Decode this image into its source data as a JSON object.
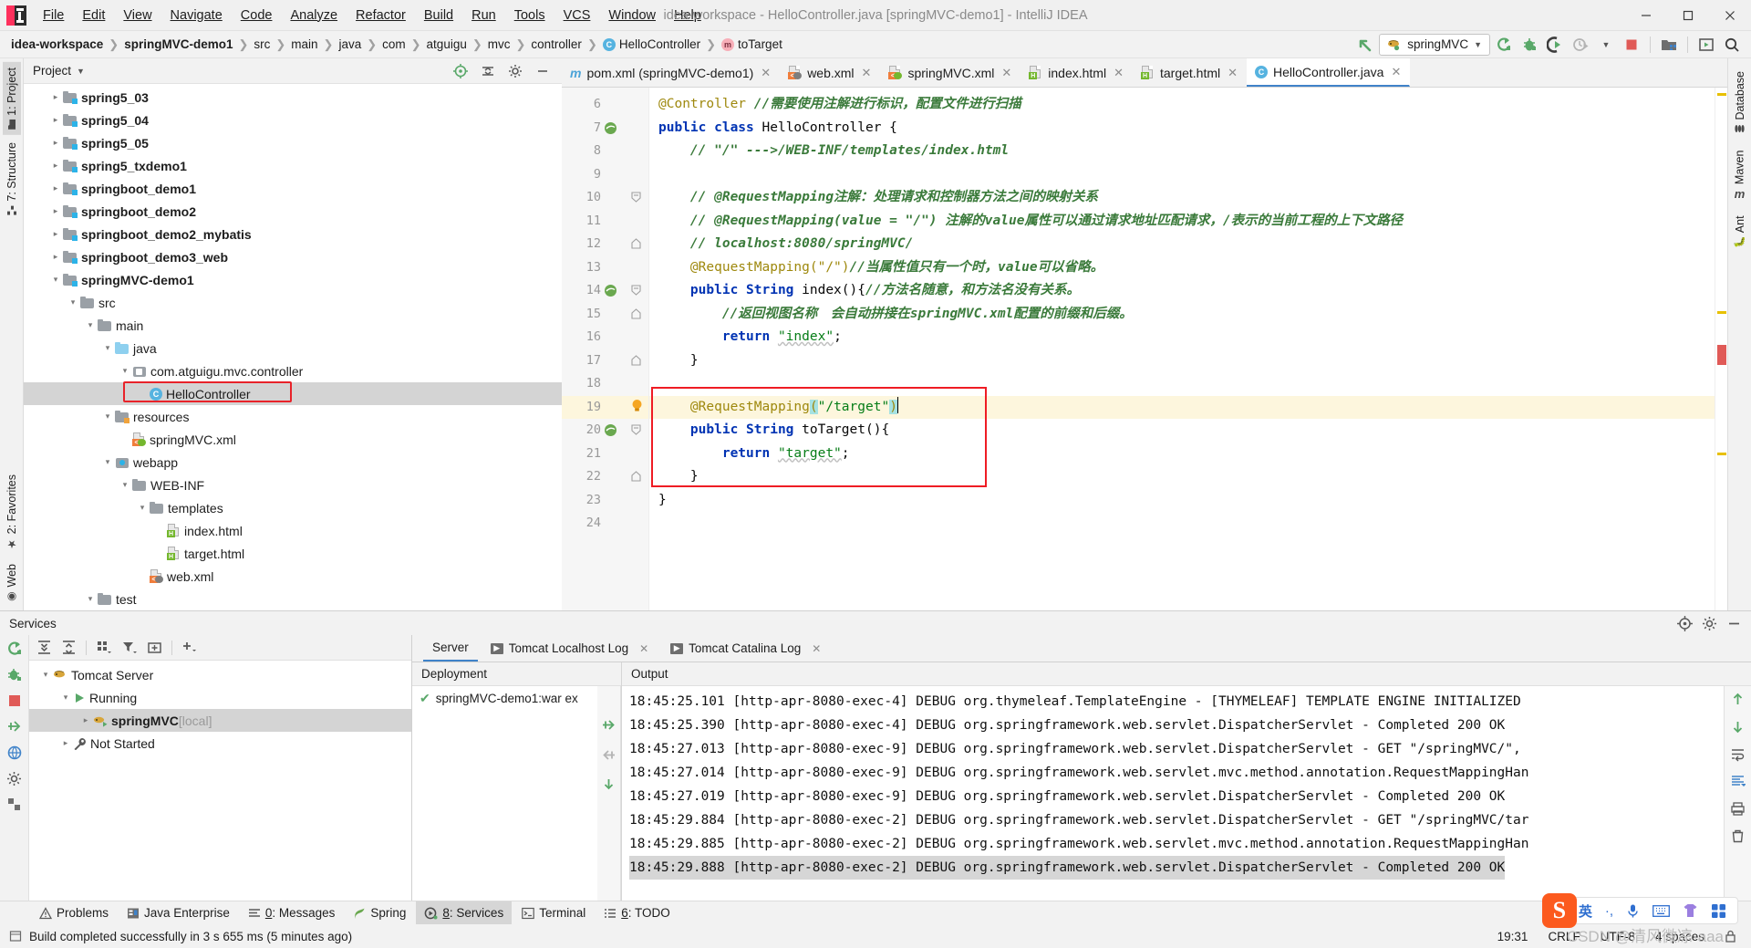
{
  "window": {
    "title": "idea-workspace - HelloController.java [springMVC-demo1] - IntelliJ IDEA",
    "minimize": "–",
    "maximize": "❐",
    "close": "✕"
  },
  "menubar": {
    "items": [
      "File",
      "Edit",
      "View",
      "Navigate",
      "Code",
      "Analyze",
      "Refactor",
      "Build",
      "Run",
      "Tools",
      "VCS",
      "Window",
      "Help"
    ]
  },
  "breadcrumb": {
    "items": [
      {
        "label": "idea-workspace",
        "bold": true,
        "icon": "none"
      },
      {
        "label": "springMVC-demo1",
        "bold": true,
        "icon": "none"
      },
      {
        "label": "src",
        "bold": false,
        "icon": "none"
      },
      {
        "label": "main",
        "bold": false,
        "icon": "none"
      },
      {
        "label": "java",
        "bold": false,
        "icon": "none"
      },
      {
        "label": "com",
        "bold": false,
        "icon": "none"
      },
      {
        "label": "atguigu",
        "bold": false,
        "icon": "none"
      },
      {
        "label": "mvc",
        "bold": false,
        "icon": "none"
      },
      {
        "label": "controller",
        "bold": false,
        "icon": "none"
      },
      {
        "label": "HelloController",
        "bold": false,
        "icon": "class"
      },
      {
        "label": "toTarget",
        "bold": false,
        "icon": "method"
      }
    ]
  },
  "toolbar": {
    "run_config": "springMVC",
    "dropdown_caret": "▼",
    "icons": [
      "back-arrow-icon",
      "rerun-icon",
      "debug-icon",
      "run-with-coverage-icon",
      "profiler-icon",
      "stop-icon",
      "project-structure-icon",
      "update-app-icon",
      "search-everywhere-icon"
    ],
    "accent_green": "#59a869",
    "accent_red": "#e05a57",
    "accent_blue": "#4083c9"
  },
  "left_rail": {
    "top": [
      {
        "label": "1: Project",
        "active": true,
        "icon": "project-icon"
      },
      {
        "label": "7: Structure",
        "active": false,
        "icon": "structure-icon"
      }
    ],
    "bottom": [
      {
        "label": "2: Favorites",
        "active": false,
        "icon": "star-icon"
      },
      {
        "label": "Web",
        "active": false,
        "icon": "web-icon"
      }
    ]
  },
  "right_rail": {
    "items": [
      {
        "label": "Database",
        "icon": "database-icon"
      },
      {
        "label": "Maven",
        "icon": "maven-icon"
      },
      {
        "label": "Ant",
        "icon": "ant-icon"
      }
    ]
  },
  "project_panel": {
    "title": "Project",
    "title_caret": "▾",
    "tree": [
      {
        "indent": 1,
        "twist": "▸",
        "icon": "module-folder",
        "label": "spring5_03",
        "bold": true,
        "selected": false
      },
      {
        "indent": 1,
        "twist": "▸",
        "icon": "module-folder",
        "label": "spring5_04",
        "bold": true,
        "selected": false
      },
      {
        "indent": 1,
        "twist": "▸",
        "icon": "module-folder",
        "label": "spring5_05",
        "bold": true,
        "selected": false
      },
      {
        "indent": 1,
        "twist": "▸",
        "icon": "module-folder",
        "label": "spring5_txdemo1",
        "bold": true,
        "selected": false
      },
      {
        "indent": 1,
        "twist": "▸",
        "icon": "module-folder",
        "label": "springboot_demo1",
        "bold": true,
        "selected": false
      },
      {
        "indent": 1,
        "twist": "▸",
        "icon": "module-folder",
        "label": "springboot_demo2",
        "bold": true,
        "selected": false
      },
      {
        "indent": 1,
        "twist": "▸",
        "icon": "module-folder",
        "label": "springboot_demo2_mybatis",
        "bold": true,
        "selected": false
      },
      {
        "indent": 1,
        "twist": "▸",
        "icon": "module-folder",
        "label": "springboot_demo3_web",
        "bold": true,
        "selected": false
      },
      {
        "indent": 1,
        "twist": "▾",
        "icon": "module-folder",
        "label": "springMVC-demo1",
        "bold": true,
        "selected": false
      },
      {
        "indent": 2,
        "twist": "▾",
        "icon": "folder",
        "label": "src",
        "bold": false,
        "selected": false
      },
      {
        "indent": 3,
        "twist": "▾",
        "icon": "folder",
        "label": "main",
        "bold": false,
        "selected": false
      },
      {
        "indent": 4,
        "twist": "▾",
        "icon": "source-folder",
        "label": "java",
        "bold": false,
        "selected": false
      },
      {
        "indent": 5,
        "twist": "▾",
        "icon": "package",
        "label": "com.atguigu.mvc.controller",
        "bold": false,
        "selected": false
      },
      {
        "indent": 6,
        "twist": "",
        "icon": "java-class",
        "label": "HelloController",
        "bold": false,
        "selected": true,
        "highlight": true
      },
      {
        "indent": 4,
        "twist": "▾",
        "icon": "resource-folder",
        "label": "resources",
        "bold": false,
        "selected": false
      },
      {
        "indent": 5,
        "twist": "",
        "icon": "spring-xml",
        "label": "springMVC.xml",
        "bold": false,
        "selected": false
      },
      {
        "indent": 4,
        "twist": "▾",
        "icon": "webapp-folder",
        "label": "webapp",
        "bold": false,
        "selected": false
      },
      {
        "indent": 5,
        "twist": "▾",
        "icon": "folder",
        "label": "WEB-INF",
        "bold": false,
        "selected": false
      },
      {
        "indent": 6,
        "twist": "▾",
        "icon": "folder",
        "label": "templates",
        "bold": false,
        "selected": false
      },
      {
        "indent": 7,
        "twist": "",
        "icon": "html-file",
        "label": "index.html",
        "bold": false,
        "selected": false
      },
      {
        "indent": 7,
        "twist": "",
        "icon": "html-file",
        "label": "target.html",
        "bold": false,
        "selected": false
      },
      {
        "indent": 6,
        "twist": "",
        "icon": "web-xml",
        "label": "web.xml",
        "bold": false,
        "selected": false
      },
      {
        "indent": 3,
        "twist": "▾",
        "icon": "folder",
        "label": "test",
        "bold": false,
        "selected": false
      }
    ]
  },
  "editor": {
    "tabs": [
      {
        "label": "pom.xml (springMVC-demo1)",
        "icon": "maven-file",
        "active": false,
        "close": "✕"
      },
      {
        "label": "web.xml",
        "icon": "web-xml",
        "active": false,
        "close": "✕"
      },
      {
        "label": "springMVC.xml",
        "icon": "spring-xml",
        "active": false,
        "close": "✕"
      },
      {
        "label": "index.html",
        "icon": "html-file",
        "active": false,
        "close": "✕"
      },
      {
        "label": "target.html",
        "icon": "html-file",
        "active": false,
        "close": "✕"
      },
      {
        "label": "HelloController.java",
        "icon": "java-class",
        "active": true,
        "close": "✕"
      }
    ],
    "lines": [
      {
        "n": 6,
        "gutter": "",
        "fold": "",
        "highlight": false,
        "segments": [
          {
            "t": "@Controller ",
            "c": "ann"
          },
          {
            "t": "//需要使用注解进行标识，配置文件进行扫描",
            "c": "cmt-g"
          }
        ]
      },
      {
        "n": 7,
        "gutter": "bean",
        "fold": "",
        "highlight": false,
        "segments": [
          {
            "t": "public class ",
            "c": "kw"
          },
          {
            "t": "HelloController {",
            "c": "plain"
          }
        ]
      },
      {
        "n": 8,
        "gutter": "",
        "fold": "",
        "highlight": false,
        "segments": [
          {
            "t": "    // \"/\" --->/WEB-INF/templates/index.html",
            "c": "cmt-g"
          }
        ]
      },
      {
        "n": 9,
        "gutter": "",
        "fold": "",
        "highlight": false,
        "segments": []
      },
      {
        "n": 10,
        "gutter": "",
        "fold": "open",
        "highlight": false,
        "segments": [
          {
            "t": "    // @RequestMapping注解：处理请求和控制器方法之间的映射关系",
            "c": "cmt-g"
          }
        ]
      },
      {
        "n": 11,
        "gutter": "",
        "fold": "",
        "highlight": false,
        "segments": [
          {
            "t": "    // @RequestMapping(value = \"/\") 注解的value属性可以通过请求地址匹配请求，/表示的当前工程的上下文路径",
            "c": "cmt-g"
          }
        ]
      },
      {
        "n": 12,
        "gutter": "",
        "fold": "end",
        "highlight": false,
        "segments": [
          {
            "t": "    // localhost:8080/springMVC/",
            "c": "cmt-g"
          }
        ]
      },
      {
        "n": 13,
        "gutter": "",
        "fold": "",
        "highlight": false,
        "segments": [
          {
            "t": "    @RequestMapping(\"/\")",
            "c": "ann"
          },
          {
            "t": "//当属性值只有一个时，value可以省略。",
            "c": "cmt-g"
          }
        ]
      },
      {
        "n": 14,
        "gutter": "bean",
        "fold": "open",
        "highlight": false,
        "segments": [
          {
            "t": "    public String ",
            "c": "kw"
          },
          {
            "t": "index(){",
            "c": "plain"
          },
          {
            "t": "//方法名随意，和方法名没有关系。",
            "c": "cmt-g"
          }
        ]
      },
      {
        "n": 15,
        "gutter": "",
        "fold": "end",
        "highlight": false,
        "segments": [
          {
            "t": "        //返回视图名称　会自动拼接在springMVC.xml配置的前缀和后缀。",
            "c": "cmt-g"
          }
        ]
      },
      {
        "n": 16,
        "gutter": "",
        "fold": "",
        "highlight": false,
        "segments": [
          {
            "t": "        return ",
            "c": "kw"
          },
          {
            "t": "\"index\"",
            "c": "str-u"
          },
          {
            "t": ";",
            "c": "plain"
          }
        ]
      },
      {
        "n": 17,
        "gutter": "",
        "fold": "end",
        "highlight": false,
        "segments": [
          {
            "t": "    }",
            "c": "plain"
          }
        ]
      },
      {
        "n": 18,
        "gutter": "",
        "fold": "",
        "highlight": false,
        "segments": []
      },
      {
        "n": 19,
        "gutter": "bulb",
        "fold": "",
        "highlight": true,
        "segments": [
          {
            "t": "    @RequestMapping",
            "c": "ann"
          },
          {
            "t": "(",
            "c": "sel"
          },
          {
            "t": "\"/target\"",
            "c": "str"
          },
          {
            "t": ")",
            "c": "sel"
          },
          {
            "t": "│",
            "c": "caret"
          }
        ]
      },
      {
        "n": 20,
        "gutter": "bean",
        "fold": "open",
        "highlight": false,
        "segments": [
          {
            "t": "    public String ",
            "c": "kw"
          },
          {
            "t": "toTarget(){",
            "c": "plain"
          }
        ]
      },
      {
        "n": 21,
        "gutter": "",
        "fold": "",
        "highlight": false,
        "segments": [
          {
            "t": "        return ",
            "c": "kw"
          },
          {
            "t": "\"target\"",
            "c": "str-u"
          },
          {
            "t": ";",
            "c": "plain"
          }
        ]
      },
      {
        "n": 22,
        "gutter": "",
        "fold": "end",
        "highlight": false,
        "segments": [
          {
            "t": "    }",
            "c": "plain"
          }
        ]
      },
      {
        "n": 23,
        "gutter": "",
        "fold": "",
        "highlight": false,
        "segments": [
          {
            "t": "}",
            "c": "plain"
          }
        ]
      },
      {
        "n": 24,
        "gutter": "",
        "fold": "",
        "highlight": false,
        "segments": []
      }
    ]
  },
  "services": {
    "title": "Services",
    "tree": [
      {
        "indent": 0,
        "twist": "▾",
        "icon": "tomcat-icon",
        "label": "Tomcat Server",
        "bold": false,
        "selected": false
      },
      {
        "indent": 1,
        "twist": "▾",
        "icon": "play-icon",
        "label": "Running",
        "bold": false,
        "selected": false
      },
      {
        "indent": 2,
        "twist": "▸",
        "icon": "tomcat-run-icon",
        "label": "springMVC",
        "suffix": " [local]",
        "bold": true,
        "selected": true
      },
      {
        "indent": 1,
        "twist": "▸",
        "icon": "wrench-icon",
        "label": "Not Started",
        "bold": false,
        "selected": false
      }
    ],
    "tabs": [
      {
        "label": "Server",
        "active": true,
        "icon": "none",
        "close": ""
      },
      {
        "label": "Tomcat Localhost Log",
        "active": false,
        "icon": "console",
        "close": "✕"
      },
      {
        "label": "Tomcat Catalina Log",
        "active": false,
        "icon": "console",
        "close": "✕"
      }
    ],
    "deployment_header": "Deployment",
    "deployment_rows": [
      {
        "status": "✔",
        "label": "springMVC-demo1:war ex"
      }
    ],
    "output_header": "Output",
    "console_lines": [
      {
        "text": "18:45:25.101 [http-apr-8080-exec-4] DEBUG org.thymeleaf.TemplateEngine - [THYMELEAF] TEMPLATE ENGINE INITIALIZED",
        "selected": false
      },
      {
        "text": "18:45:25.390 [http-apr-8080-exec-4] DEBUG org.springframework.web.servlet.DispatcherServlet - Completed 200 OK",
        "selected": false
      },
      {
        "text": "18:45:27.013 [http-apr-8080-exec-9] DEBUG org.springframework.web.servlet.DispatcherServlet - GET \"/springMVC/\", ",
        "selected": false
      },
      {
        "text": "18:45:27.014 [http-apr-8080-exec-9] DEBUG org.springframework.web.servlet.mvc.method.annotation.RequestMappingHan",
        "selected": false
      },
      {
        "text": "18:45:27.019 [http-apr-8080-exec-9] DEBUG org.springframework.web.servlet.DispatcherServlet - Completed 200 OK",
        "selected": false
      },
      {
        "text": "18:45:29.884 [http-apr-8080-exec-2] DEBUG org.springframework.web.servlet.DispatcherServlet - GET \"/springMVC/tar",
        "selected": false
      },
      {
        "text": "18:45:29.885 [http-apr-8080-exec-2] DEBUG org.springframework.web.servlet.mvc.method.annotation.RequestMappingHan",
        "selected": false
      },
      {
        "text": "18:45:29.888 [http-apr-8080-exec-2] DEBUG org.springframework.web.servlet.DispatcherServlet - Completed 200 OK",
        "selected": true
      }
    ]
  },
  "bottom_bar": {
    "items": [
      {
        "label": "Problems",
        "mnemonic": "",
        "icon": "warning-icon",
        "active": false
      },
      {
        "label": "Java Enterprise",
        "mnemonic": "",
        "icon": "java-ee-icon",
        "active": false
      },
      {
        "label": "Messages",
        "mnemonic": "0",
        "icon": "messages-icon",
        "active": false
      },
      {
        "label": "Spring",
        "mnemonic": "",
        "icon": "spring-icon",
        "active": false
      },
      {
        "label": "Services",
        "mnemonic": "8",
        "icon": "services-icon",
        "active": true
      },
      {
        "label": "Terminal",
        "mnemonic": "",
        "icon": "terminal-icon",
        "active": false
      },
      {
        "label": "TODO",
        "mnemonic": "6",
        "icon": "todo-icon",
        "active": false
      }
    ]
  },
  "status_bar": {
    "message": "Build completed successfully in 3 s 655 ms (5 minutes ago)",
    "time": "19:31",
    "line_separator": "CRLF",
    "encoding": "UTF-8",
    "indent": "4 spaces",
    "lock_icon": "🔒"
  },
  "ime_bar": {
    "logo": "S",
    "mode": "英",
    "items": [
      "punctuation-icon",
      "microphone-icon",
      "keyboard-icon",
      "skin-icon",
      "apps-icon"
    ]
  },
  "watermark": "CSDN @清风微凉·aaa"
}
